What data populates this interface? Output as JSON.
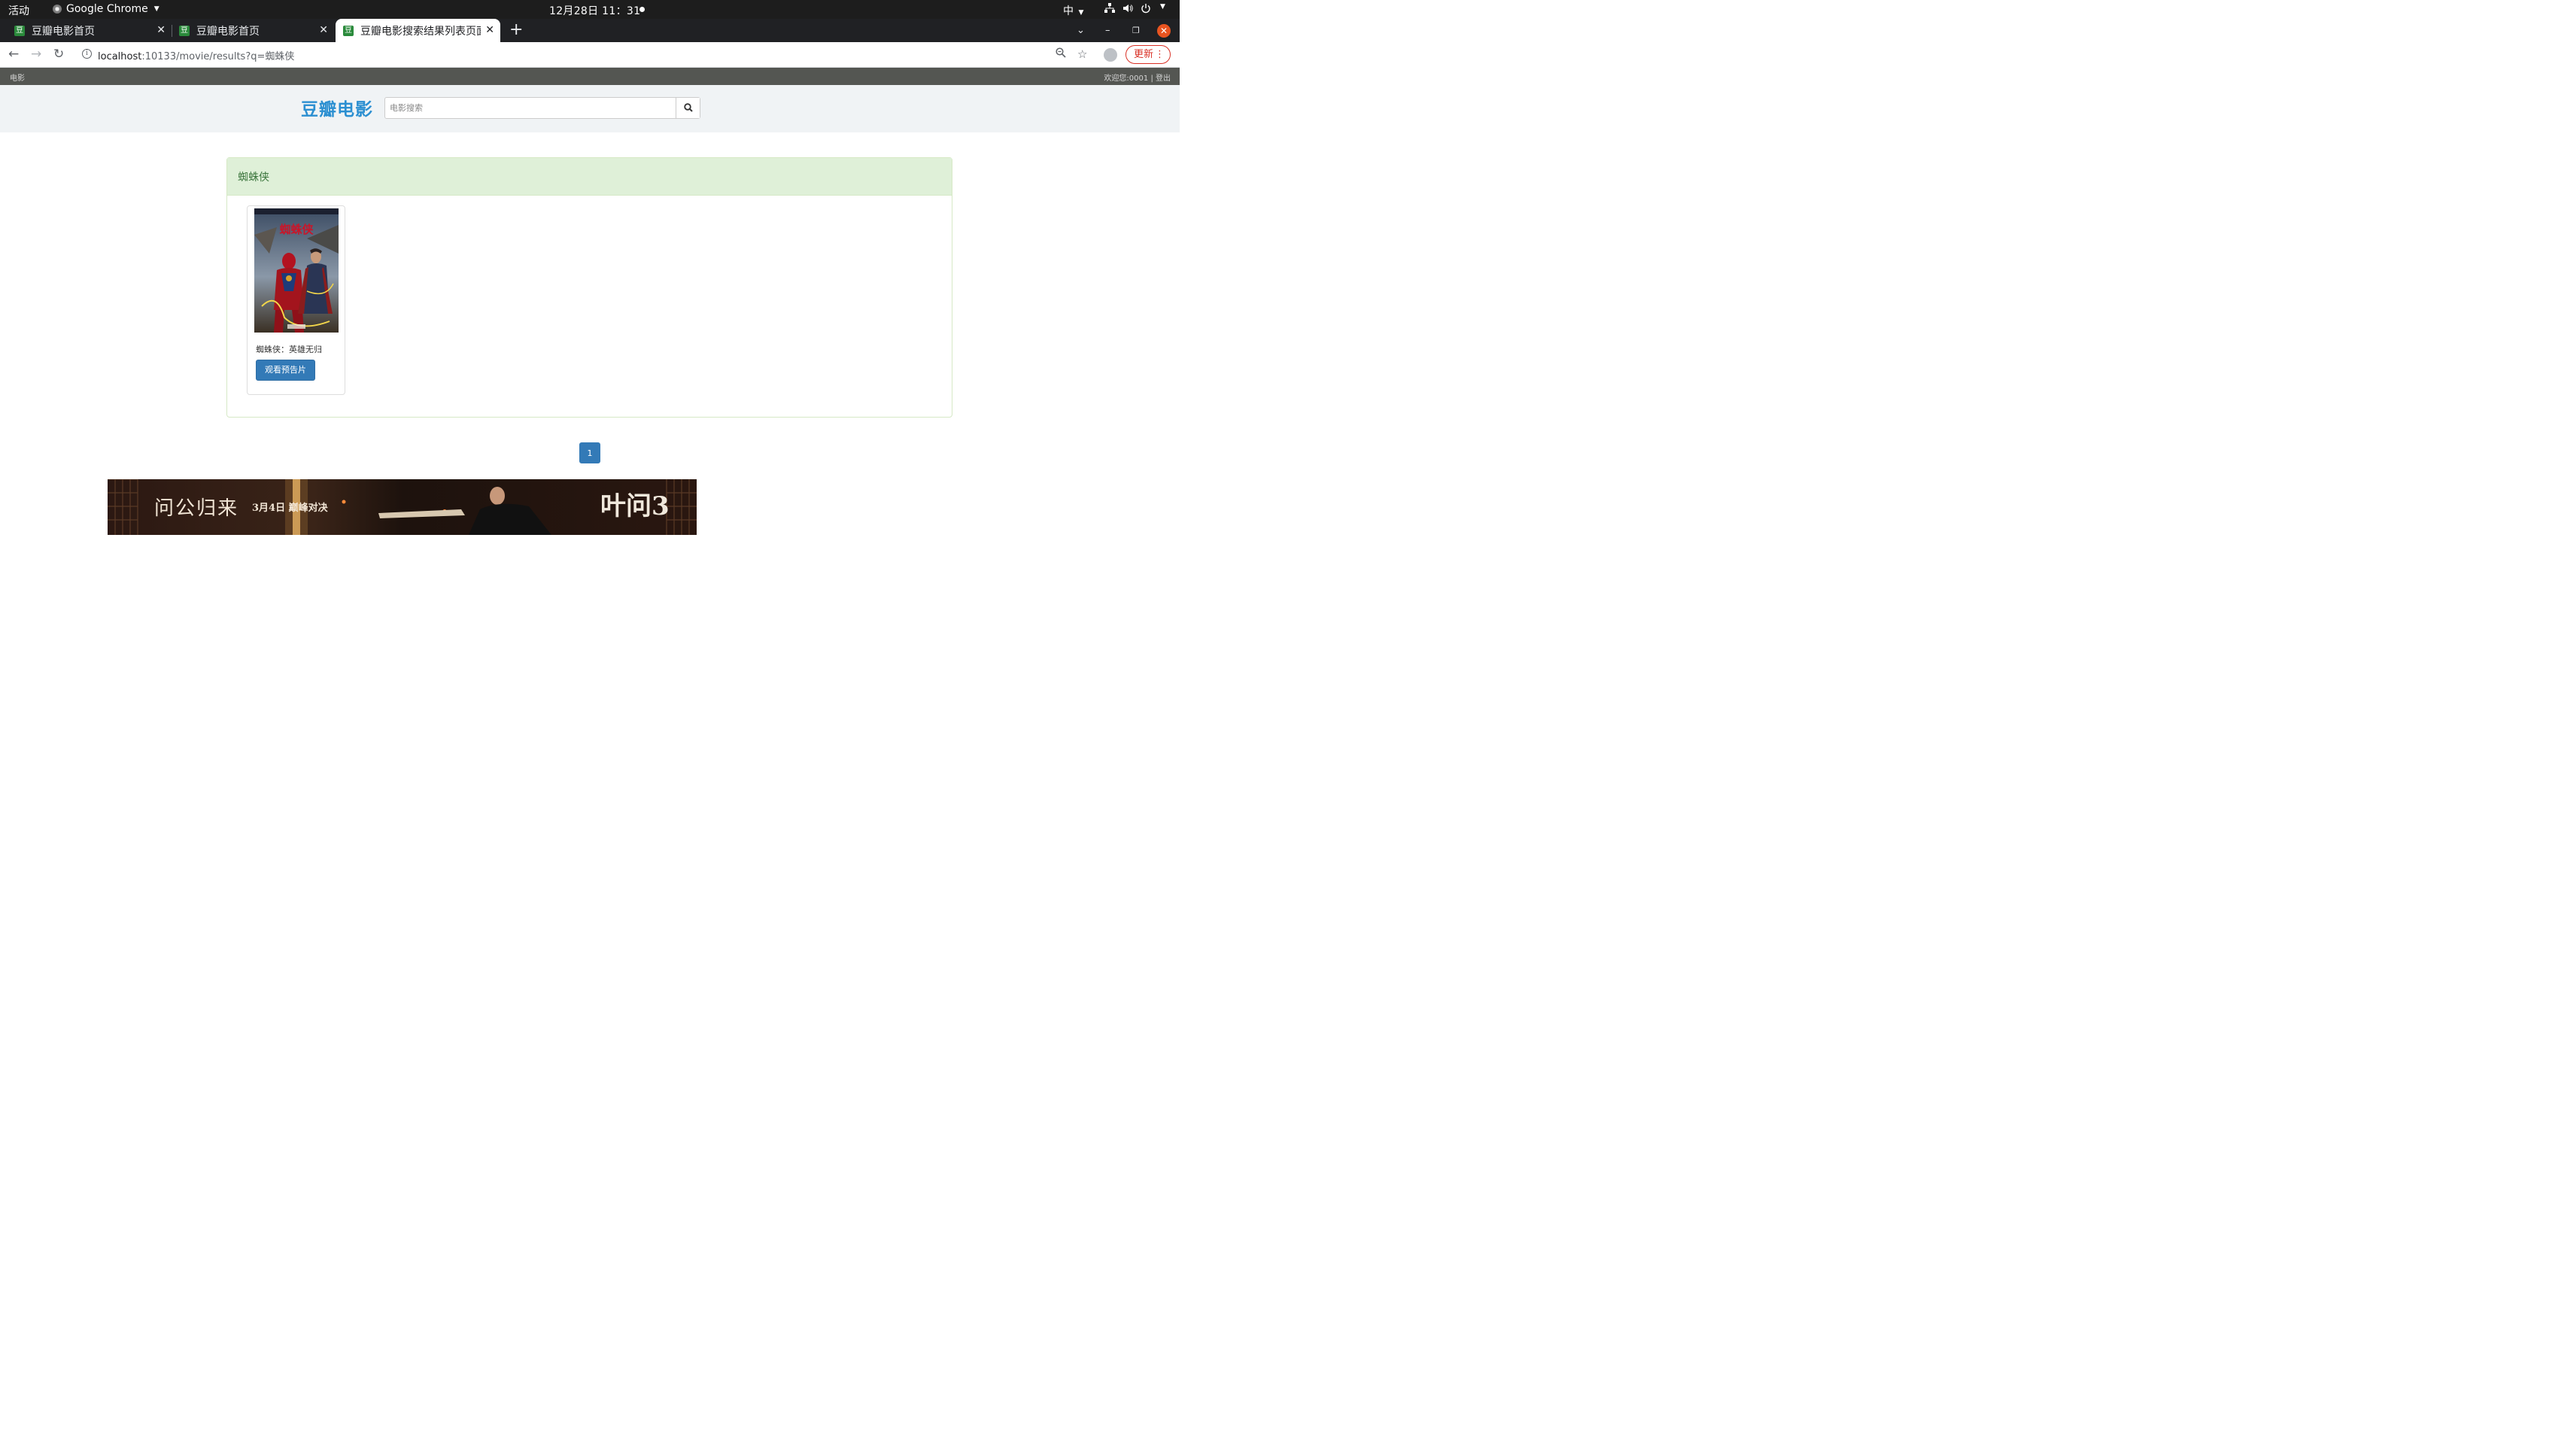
{
  "os_bar": {
    "activities": "活动",
    "app_name": "Google Chrome",
    "clock": "12月28日  11：31",
    "ime": "中"
  },
  "tabs": [
    {
      "favicon": "豆",
      "title": "豆瓣电影首页"
    },
    {
      "favicon": "豆",
      "title": "豆瓣电影首页"
    },
    {
      "favicon": "豆",
      "title": "豆瓣电影搜索结果列表页面"
    }
  ],
  "omnibox": {
    "host": "localhost",
    "path": ":10133/movie/results?q=蜘蛛侠"
  },
  "toolbar": {
    "update_label": "更新"
  },
  "site_nav": {
    "left": "电影",
    "welcome": "欢迎您:0001",
    "separator": "|",
    "logout": "登出"
  },
  "header": {
    "logo": "豆瓣电影",
    "search_placeholder": "电影搜索"
  },
  "results": {
    "query_heading": "蜘蛛侠",
    "items": [
      {
        "title": "蜘蛛侠：英雄无归",
        "button": "观看预告片",
        "poster_title": "蜘蛛侠"
      }
    ]
  },
  "pagination": {
    "current": "1"
  },
  "banner": {
    "title": "问公归来",
    "date": "3月4日 巅峰对决",
    "film": "叶问3"
  },
  "colors": {
    "accent": "#337ab7",
    "logo": "#2b8fd1",
    "panel_heading_bg": "#dff0d8",
    "panel_heading_text": "#3c763d",
    "update": "#d93025"
  }
}
